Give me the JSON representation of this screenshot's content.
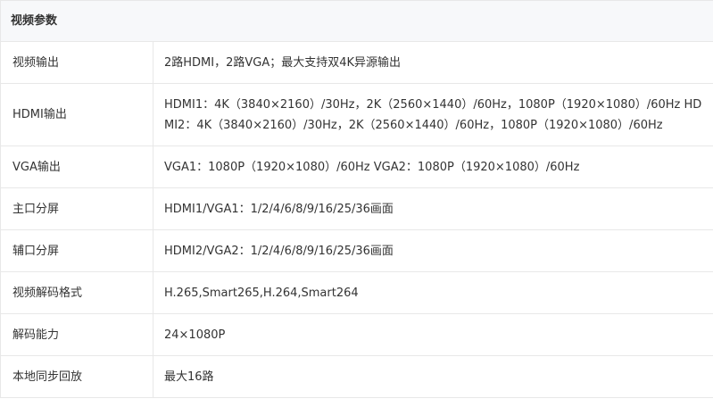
{
  "section": {
    "title": "视频参数"
  },
  "rows": [
    {
      "label": "视频输出",
      "value": "2路HDMI，2路VGA；最大支持双4K异源输出"
    },
    {
      "label": "HDMI输出",
      "value": "HDMI1：4K（3840×2160）/30Hz，2K（2560×1440）/60Hz，1080P（1920×1080）/60Hz HDMI2：4K（3840×2160）/30Hz，2K（2560×1440）/60Hz，1080P（1920×1080）/60Hz"
    },
    {
      "label": "VGA输出",
      "value": "VGA1：1080P（1920×1080）/60Hz VGA2：1080P（1920×1080）/60Hz"
    },
    {
      "label": "主口分屏",
      "value": "HDMI1/VGA1：1/2/4/6/8/9/16/25/36画面"
    },
    {
      "label": "辅口分屏",
      "value": "HDMI2/VGA2：1/2/4/6/8/9/16/25/36画面"
    },
    {
      "label": "视频解码格式",
      "value": "H.265,Smart265,H.264,Smart264"
    },
    {
      "label": "解码能力",
      "value": "24×1080P"
    },
    {
      "label": "本地同步回放",
      "value": "最大16路"
    }
  ]
}
